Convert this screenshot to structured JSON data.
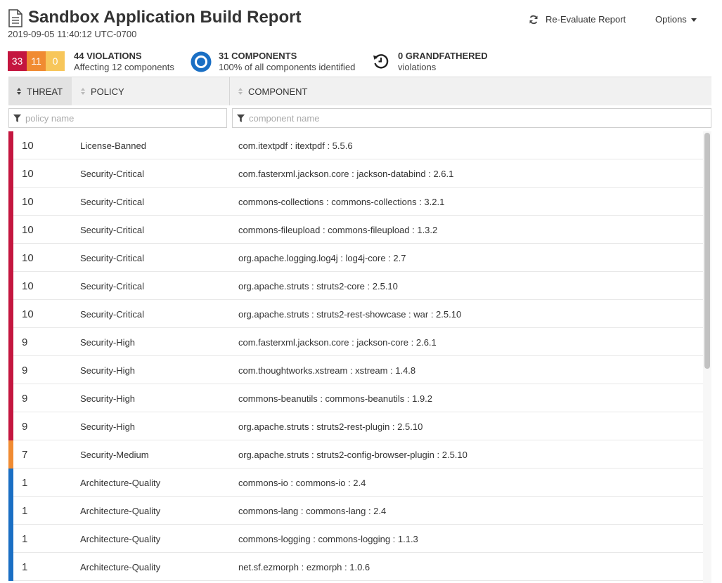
{
  "header": {
    "title": "Sandbox Application Build Report",
    "timestamp": "2019-09-05 11:40:12 UTC-0700",
    "reevaluate_label": "Re-Evaluate Report",
    "options_label": "Options"
  },
  "summary": {
    "badges": {
      "critical": "33",
      "severe": "11",
      "moderate": "0"
    },
    "violations": {
      "heading": "44 VIOLATIONS",
      "sub": "Affecting 12 components"
    },
    "components": {
      "heading": "31 COMPONENTS",
      "sub": "100% of all components identified"
    },
    "grandfathered": {
      "heading": "0 GRANDFATHERED",
      "sub": "violations"
    }
  },
  "table": {
    "headers": {
      "threat": "THREAT",
      "policy": "POLICY",
      "component": "COMPONENT"
    },
    "filters": {
      "policy_placeholder": "policy name",
      "component_placeholder": "component name"
    },
    "rows": [
      {
        "threat": "10",
        "policy": "License-Banned",
        "component": "com.itextpdf : itextpdf : 5.5.6",
        "level": "critical"
      },
      {
        "threat": "10",
        "policy": "Security-Critical",
        "component": "com.fasterxml.jackson.core : jackson-databind : 2.6.1",
        "level": "critical"
      },
      {
        "threat": "10",
        "policy": "Security-Critical",
        "component": "commons-collections : commons-collections : 3.2.1",
        "level": "critical"
      },
      {
        "threat": "10",
        "policy": "Security-Critical",
        "component": "commons-fileupload : commons-fileupload : 1.3.2",
        "level": "critical"
      },
      {
        "threat": "10",
        "policy": "Security-Critical",
        "component": "org.apache.logging.log4j : log4j-core : 2.7",
        "level": "critical"
      },
      {
        "threat": "10",
        "policy": "Security-Critical",
        "component": "org.apache.struts : struts2-core : 2.5.10",
        "level": "critical"
      },
      {
        "threat": "10",
        "policy": "Security-Critical",
        "component": "org.apache.struts : struts2-rest-showcase : war : 2.5.10",
        "level": "critical"
      },
      {
        "threat": "9",
        "policy": "Security-High",
        "component": "com.fasterxml.jackson.core : jackson-core : 2.6.1",
        "level": "critical"
      },
      {
        "threat": "9",
        "policy": "Security-High",
        "component": "com.thoughtworks.xstream : xstream : 1.4.8",
        "level": "critical"
      },
      {
        "threat": "9",
        "policy": "Security-High",
        "component": "commons-beanutils : commons-beanutils : 1.9.2",
        "level": "critical"
      },
      {
        "threat": "9",
        "policy": "Security-High",
        "component": "org.apache.struts : struts2-rest-plugin : 2.5.10",
        "level": "critical"
      },
      {
        "threat": "7",
        "policy": "Security-Medium",
        "component": "org.apache.struts : struts2-config-browser-plugin : 2.5.10",
        "level": "severe"
      },
      {
        "threat": "1",
        "policy": "Architecture-Quality",
        "component": "commons-io : commons-io : 2.4",
        "level": "low"
      },
      {
        "threat": "1",
        "policy": "Architecture-Quality",
        "component": "commons-lang : commons-lang : 2.4",
        "level": "low"
      },
      {
        "threat": "1",
        "policy": "Architecture-Quality",
        "component": "commons-logging : commons-logging : 1.1.3",
        "level": "low"
      },
      {
        "threat": "1",
        "policy": "Architecture-Quality",
        "component": "net.sf.ezmorph : ezmorph : 1.0.6",
        "level": "low"
      }
    ]
  },
  "colors": {
    "critical": "#c4163f",
    "severe": "#f08b32",
    "moderate": "#f7c65a",
    "low": "#1a6fc4",
    "components_icon": "#1a6fc4"
  },
  "icons": {
    "title": "document-icon",
    "reevaluate": "refresh-icon",
    "options": "caret-down-icon",
    "components": "target-circle-icon",
    "grandfathered": "history-icon",
    "filter": "filter-funnel-icon",
    "sort": "sort-arrows-icon"
  }
}
